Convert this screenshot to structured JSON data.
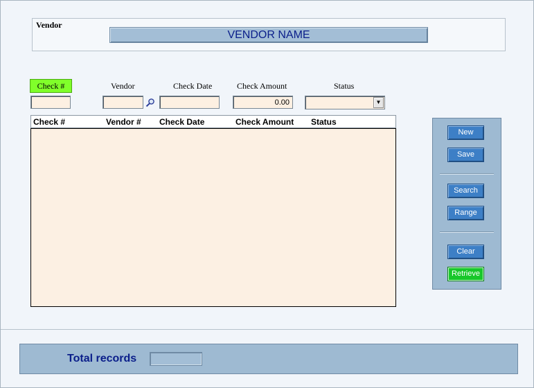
{
  "vendor": {
    "caption": "Vendor",
    "name": "VENDOR NAME"
  },
  "filters": {
    "check_label": "Check #",
    "vendor_label": "Vendor",
    "check_date_label": "Check Date",
    "check_amount_label": "Check Amount",
    "status_label": "Status",
    "check_value": "",
    "vendor_value": "",
    "check_date_value": "",
    "check_amount_value": "0.00",
    "status_value": "",
    "lookup_icon": "magnifier-icon"
  },
  "grid": {
    "columns": [
      "Check #",
      "Vendor #",
      "Check Date",
      "Check Amount",
      "Status"
    ],
    "rows": []
  },
  "buttons": {
    "new": "New",
    "save": "Save",
    "search": "Search",
    "range": "Range",
    "clear": "Clear",
    "retrieve": "Retrieve"
  },
  "footer": {
    "total_label": "Total records",
    "total_value": ""
  },
  "colors": {
    "title_text": "#0a1e8a",
    "panel": "#9ebad2",
    "button": "#3d7fc6",
    "retrieve_button": "#18c72a",
    "check_label_bg": "#80ff2a",
    "input_bg": "#fdf0e2"
  }
}
